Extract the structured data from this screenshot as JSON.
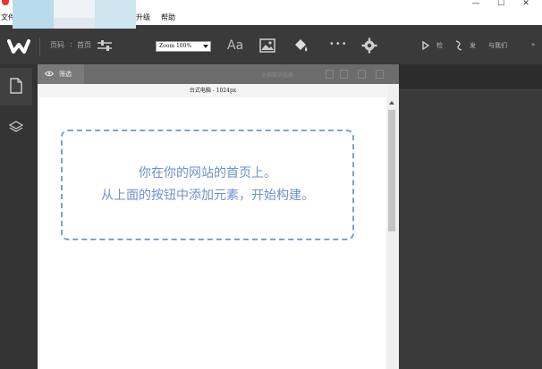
{
  "window": {
    "menu": {
      "file": "文件",
      "upgrade": "升级",
      "help": "帮助"
    },
    "controls": {
      "minimize": "—",
      "maximize": "☐",
      "close": "✕"
    }
  },
  "toolbar": {
    "page_label": "页码",
    "page_separator": ":",
    "page_value": "首页",
    "zoom_value": "Zoom 100%",
    "font_label": "Aa",
    "more_label": "•••",
    "preview_label": "检",
    "publish_label": "发",
    "contact_label": "与我们"
  },
  "canvas": {
    "preview_tab": "筛选",
    "select_all": "全部取消选择",
    "device_label": "台式电脑 - 1024px",
    "hint_line1": "你在你的网站的首页上。",
    "hint_line2": "从上面的按钮中添加元素，开始构建。"
  },
  "icons": {
    "brand": "brand-logo-icon",
    "page_settings": "sliders-icon",
    "image": "image-icon",
    "paint": "paint-bucket-icon",
    "settings": "gear-icon",
    "preview": "play-icon",
    "publish": "share-icon",
    "pages": "page-icon",
    "layers": "layers-icon",
    "eye": "eye-icon"
  },
  "colors": {
    "dark_chrome": "#3a3a3a",
    "hint_blue": "#6e91cf",
    "dashed_border": "#7c9fe0"
  }
}
